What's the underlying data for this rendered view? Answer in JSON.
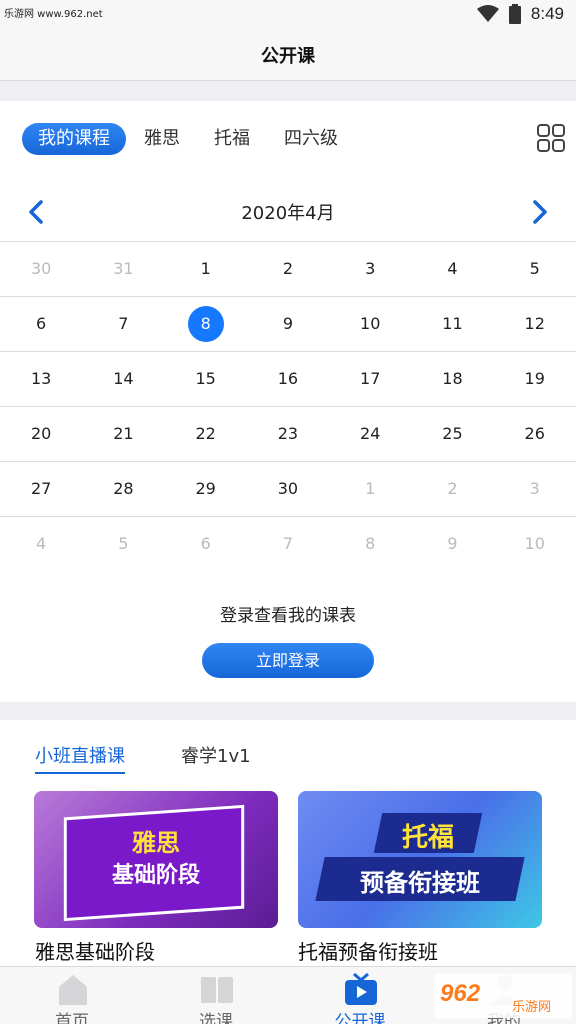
{
  "status_bar": {
    "watermark": "乐游网 www.962.net",
    "time": "8:49"
  },
  "nav": {
    "title": "公开课"
  },
  "tabs": [
    {
      "label": "我的课程",
      "active": true
    },
    {
      "label": "雅思",
      "active": false
    },
    {
      "label": "托福",
      "active": false
    },
    {
      "label": "四六级",
      "active": false
    }
  ],
  "calendar": {
    "month_label": "2020年4月",
    "weeks": [
      [
        {
          "d": "30",
          "muted": true
        },
        {
          "d": "31",
          "muted": true
        },
        {
          "d": "1"
        },
        {
          "d": "2"
        },
        {
          "d": "3"
        },
        {
          "d": "4"
        },
        {
          "d": "5"
        }
      ],
      [
        {
          "d": "6"
        },
        {
          "d": "7"
        },
        {
          "d": "8",
          "selected": true
        },
        {
          "d": "9"
        },
        {
          "d": "10"
        },
        {
          "d": "11"
        },
        {
          "d": "12"
        }
      ],
      [
        {
          "d": "13"
        },
        {
          "d": "14"
        },
        {
          "d": "15"
        },
        {
          "d": "16"
        },
        {
          "d": "17"
        },
        {
          "d": "18"
        },
        {
          "d": "19"
        }
      ],
      [
        {
          "d": "20"
        },
        {
          "d": "21"
        },
        {
          "d": "22"
        },
        {
          "d": "23"
        },
        {
          "d": "24"
        },
        {
          "d": "25"
        },
        {
          "d": "26"
        }
      ],
      [
        {
          "d": "27"
        },
        {
          "d": "28"
        },
        {
          "d": "29"
        },
        {
          "d": "30"
        },
        {
          "d": "1",
          "muted": true
        },
        {
          "d": "2",
          "muted": true
        },
        {
          "d": "3",
          "muted": true
        }
      ],
      [
        {
          "d": "4",
          "muted": true
        },
        {
          "d": "5",
          "muted": true
        },
        {
          "d": "6",
          "muted": true
        },
        {
          "d": "7",
          "muted": true
        },
        {
          "d": "8",
          "muted": true
        },
        {
          "d": "9",
          "muted": true
        },
        {
          "d": "10",
          "muted": true
        }
      ]
    ]
  },
  "login": {
    "hint": "登录查看我的课表",
    "button": "立即登录"
  },
  "sub_tabs": [
    {
      "label": "小班直播课",
      "active": true
    },
    {
      "label": "睿学1v1",
      "active": false
    }
  ],
  "courses": [
    {
      "banner_line1": "雅思",
      "banner_line2": "基础阶段",
      "name": "雅思基础阶段"
    },
    {
      "banner_line1": "托福",
      "banner_line2": "预备衔接班",
      "name": "托福预备衔接班"
    }
  ],
  "tabbar": [
    {
      "label": "首页",
      "icon": "home-icon",
      "active": false
    },
    {
      "label": "选课",
      "icon": "book-icon",
      "active": false
    },
    {
      "label": "公开课",
      "icon": "tv-icon",
      "active": true
    },
    {
      "label": "我的",
      "icon": "profile-icon",
      "active": false
    }
  ],
  "watermark_bottom": {
    "logo": "962",
    "text": "乐游网"
  },
  "colors": {
    "accent": "#1766d8",
    "muted_day": "#bbbbbb"
  }
}
